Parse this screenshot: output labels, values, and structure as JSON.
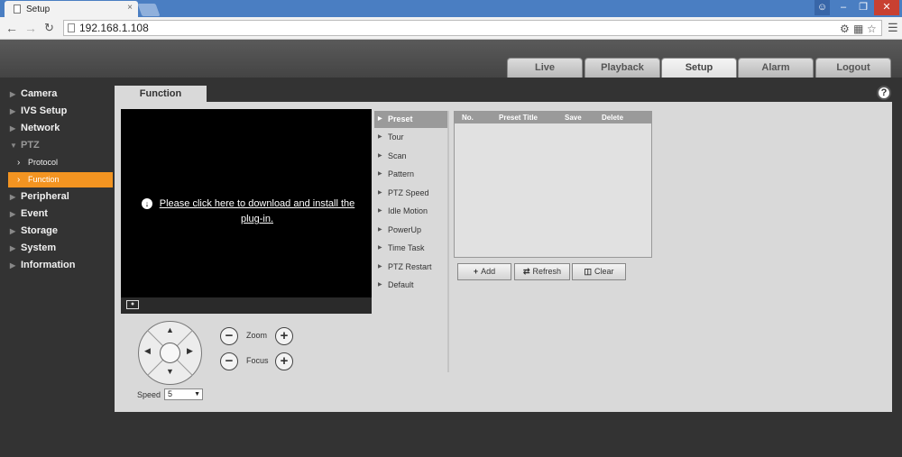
{
  "browser": {
    "tab_title": "Setup",
    "tab_close": "×",
    "url": "192.168.1.108",
    "window_min": "–",
    "window_max": "❐",
    "window_close": "✕"
  },
  "nav": {
    "tabs": [
      "Live",
      "Playback",
      "Setup",
      "Alarm",
      "Logout"
    ],
    "active": "Setup"
  },
  "sidebar": {
    "items": [
      {
        "label": "Camera"
      },
      {
        "label": "IVS Setup"
      },
      {
        "label": "Network"
      },
      {
        "label": "PTZ"
      },
      {
        "label": "Protocol"
      },
      {
        "label": "Function"
      },
      {
        "label": "Peripheral"
      },
      {
        "label": "Event"
      },
      {
        "label": "Storage"
      },
      {
        "label": "System"
      },
      {
        "label": "Information"
      }
    ],
    "active": "Function"
  },
  "main": {
    "tab_label": "Function",
    "plugin_text": "Please click here to download and install the plug-in.",
    "zoom_label": "Zoom",
    "focus_label": "Focus",
    "speed_label": "Speed",
    "speed_value": "5"
  },
  "function_list": {
    "items": [
      "Preset",
      "Tour",
      "Scan",
      "Pattern",
      "PTZ Speed",
      "Idle Motion",
      "PowerUp",
      "Time Task",
      "PTZ Restart",
      "Default"
    ],
    "active": "Preset"
  },
  "preset_table": {
    "headers": [
      "No.",
      "Preset Title",
      "Save",
      "Delete"
    ],
    "rows": []
  },
  "buttons": {
    "add": "Add",
    "refresh": "Refresh",
    "clear": "Clear"
  },
  "colors": {
    "accent": "#f39421",
    "titlebar": "#4a7ec2"
  }
}
